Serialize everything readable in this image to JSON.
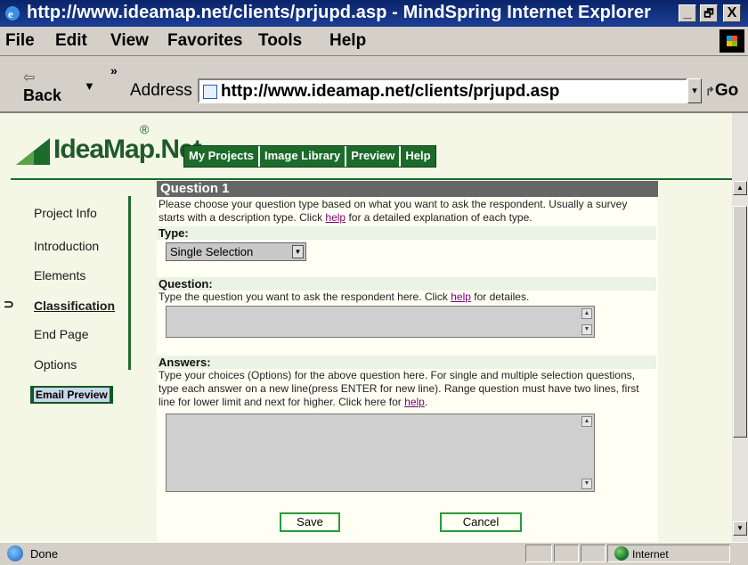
{
  "window": {
    "title": "http://www.ideamap.net/clients/prjupd.asp - MindSpring Internet Explorer",
    "min": "_",
    "restore": "🗗",
    "close": "X"
  },
  "menu": [
    "File",
    "Edit",
    "View",
    "Favorites",
    "Tools",
    "Help"
  ],
  "toolbar": {
    "back_label": "Back",
    "back_arrow": "⇦",
    "dropdown": "▼",
    "chevron": "»",
    "address_label": "Address",
    "address_value": "http://www.ideamap.net/clients/prjupd.asp",
    "go_label": "Go",
    "go_icon": "↱"
  },
  "site": {
    "logo": "IdeaMap.Net",
    "logo_reg": "®",
    "nav": [
      "My Projects",
      "Image Library",
      "Preview",
      "Help"
    ]
  },
  "sidebar": {
    "items": [
      "Project Info",
      "Introduction",
      "Elements",
      "Classification",
      "End Page",
      "Options"
    ],
    "active_index": 3,
    "active_marker": "⊃",
    "email_preview": "Email Preview"
  },
  "form": {
    "heading": "Question 1",
    "intro": "Please choose your question type based on what you want to ask the respondent. Usually a survey starts with a description type. Click",
    "intro_link": "help",
    "intro_end": "for a detailed explanation of each type.",
    "type_label": "Type:",
    "type_value": "Single Selection",
    "question_label": "Question:",
    "question_help": "Type the question you want to ask the respondent here. Click",
    "question_link": "help",
    "question_end": "for detailes.",
    "answers_label": "Answers:",
    "answers_help": "Type your choices (Options) for the above question here. For single and multiple selection questions, type each answer on a new line(press ENTER for new line). Range question must have two lines, first line for lower limit and next for higher. Click here for",
    "answers_link": "help",
    "answers_end": ".",
    "save_label": "Save",
    "cancel_label": "Cancel"
  },
  "status": {
    "text": "Done",
    "zone": "Internet"
  },
  "colors": {
    "titlebar": "#0a246a",
    "brand_green": "#1c6b2a",
    "page_bg": "#f4f7e6",
    "button_border": "#2a9a3a"
  }
}
